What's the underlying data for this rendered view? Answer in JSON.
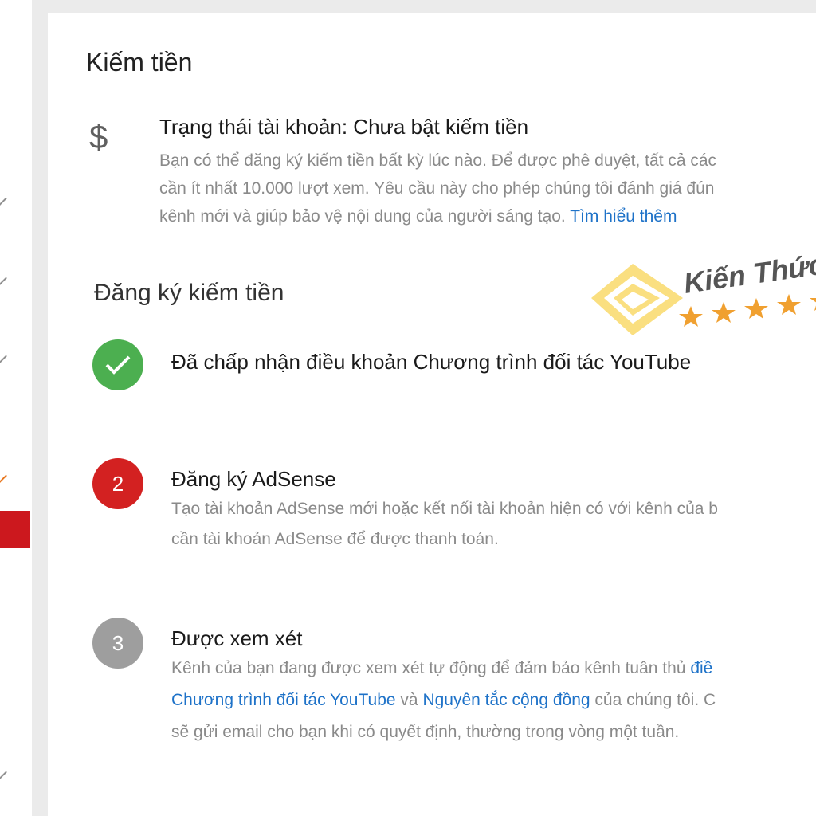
{
  "section_title": "Kiếm tiền",
  "account_status": {
    "icon": "dollar-icon",
    "icon_glyph": "$",
    "title": "Trạng thái tài khoản: Chưa bật kiếm tiền",
    "lines": [
      "Bạn có thể đăng ký kiếm tiền bất kỳ lúc nào. Để được phê duyệt, tất cả các",
      "cần ít nhất 10.000 lượt xem. Yêu cầu này cho phép chúng tôi đánh giá đún",
      "kênh mới và giúp bảo vệ nội dung của người sáng tạo."
    ],
    "learn_more": "Tìm hiểu thêm"
  },
  "signup_title": "Đăng ký kiếm tiền",
  "steps": [
    {
      "status": "done",
      "color": "#4caf50",
      "icon": "checkmark-icon",
      "title": "Đã chấp nhận điều khoản Chương trình đối tác YouTube"
    },
    {
      "number": "2",
      "status": "active",
      "color": "#d32121",
      "title": "Đăng ký AdSense",
      "lines": [
        "Tạo tài khoản AdSense mới hoặc kết nối tài khoản hiện có với kênh của b",
        "cần tài khoản AdSense để được thanh toán."
      ]
    },
    {
      "number": "3",
      "status": "pending",
      "color": "#9e9e9e",
      "title": "Được xem xét",
      "line1_text": "Kênh của bạn đang được xem xét tự động để đảm bảo kênh tuân thủ ",
      "line1_link": "điề",
      "line2_link1": "Chương trình đối tác YouTube",
      "line2_mid": " và ",
      "line2_link2": "Nguyên tắc cộng đồng",
      "line2_text": " của chúng tôi. C",
      "line3": "sẽ gửi email cho bạn khi có quyết định, thường trong vòng một tuần."
    }
  ],
  "watermark": {
    "text": "Kiến Thức",
    "colors": {
      "diamond": "#f5c518",
      "stars": "#f0a030",
      "text": "#555555"
    }
  },
  "colors": {
    "link": "#1e72c8",
    "sidebar_active": "#cc181e"
  }
}
